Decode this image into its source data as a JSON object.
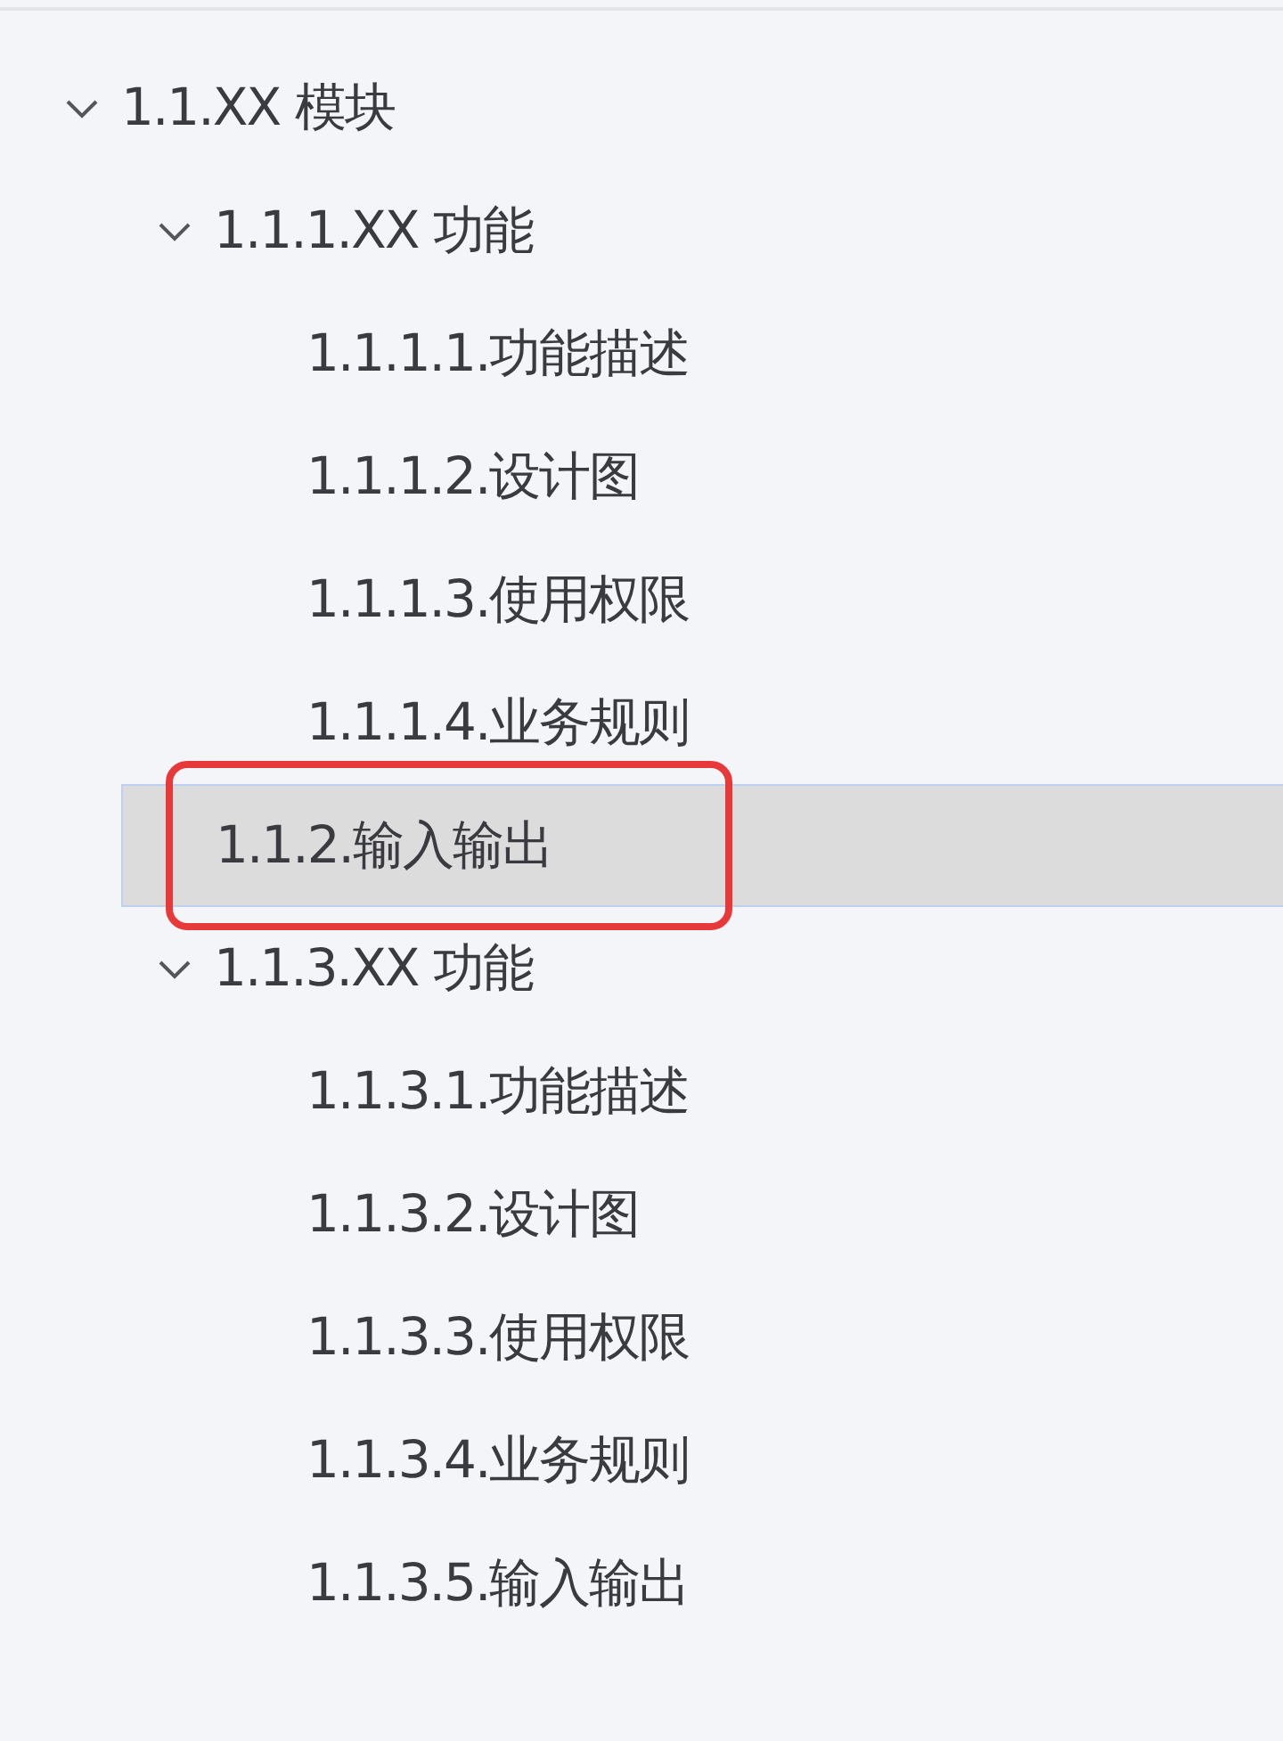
{
  "tree": [
    {
      "label": "1.1.XX 模块",
      "expanded": true,
      "selected": false,
      "children": [
        {
          "label": "1.1.1.XX 功能",
          "expanded": true,
          "selected": false,
          "children": [
            {
              "label": "1.1.1.1.功能描述",
              "selected": false
            },
            {
              "label": "1.1.1.2.设计图",
              "selected": false
            },
            {
              "label": "1.1.1.3.使用权限",
              "selected": false
            },
            {
              "label": "1.1.1.4.业务规则",
              "selected": false
            }
          ]
        },
        {
          "label": "1.1.2.输入输出",
          "selected": true,
          "annotated": true
        },
        {
          "label": "1.1.3.XX 功能",
          "expanded": true,
          "selected": false,
          "children": [
            {
              "label": "1.1.3.1.功能描述",
              "selected": false
            },
            {
              "label": "1.1.3.2.设计图",
              "selected": false
            },
            {
              "label": "1.1.3.3.使用权限",
              "selected": false
            },
            {
              "label": "1.1.3.4.业务规则",
              "selected": false
            },
            {
              "label": "1.1.3.5.输入输出",
              "selected": false
            }
          ]
        }
      ]
    }
  ]
}
